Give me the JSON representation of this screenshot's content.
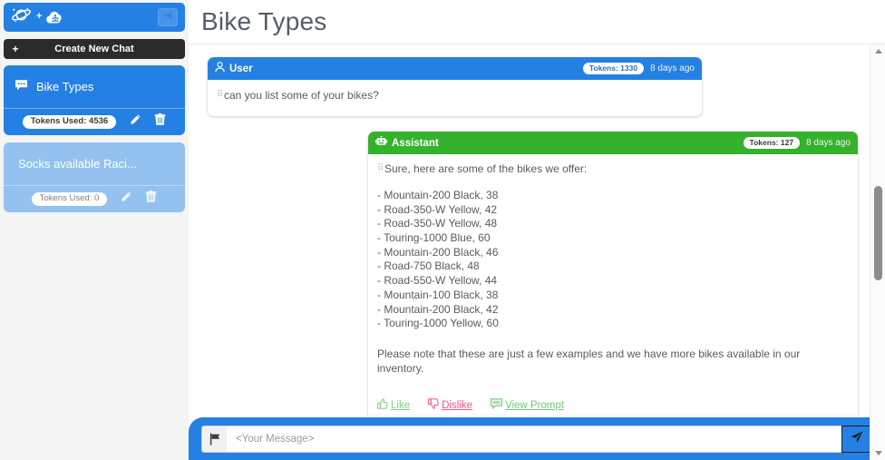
{
  "sidebar": {
    "logo_icon": "planet-sparkle-icon",
    "plus_symbol": "+",
    "cloud_icon": "cloud-brain-icon",
    "collapse_icon": "arrow-right-to-bracket-icon",
    "new_chat": {
      "plus": "+",
      "label": "Create New Chat"
    },
    "chats": [
      {
        "title": "Bike Types",
        "icon": "comment-dots-icon",
        "tokens_label": "Tokens Used: 4536",
        "edit_icon": "pencil-icon",
        "delete_icon": "trash-icon",
        "active": true
      },
      {
        "title": "Socks available Raci...",
        "icon": "comment-dots-icon",
        "tokens_label": "Tokens Used: 0",
        "edit_icon": "pencil-icon",
        "delete_icon": "trash-icon",
        "active": false
      }
    ]
  },
  "header": {
    "title": "Bike Types"
  },
  "messages": {
    "user": {
      "role_icon": "user-icon",
      "role_label": "User",
      "tokens": "Tokens: 1330",
      "timestamp": "8 days ago",
      "text": "can you list some of your bikes?"
    },
    "assistant": {
      "role_icon": "robot-icon",
      "role_label": "Assistant",
      "tokens": "Tokens: 127",
      "timestamp": "8 days ago",
      "intro": "Sure, here are some of the bikes we offer:",
      "bikes": [
        "- Mountain-200 Black, 38",
        "- Road-350-W Yellow, 42",
        "- Road-350-W Yellow, 48",
        "- Touring-1000 Blue, 60",
        "- Mountain-200 Black, 46",
        "- Road-750 Black, 48",
        "- Road-550-W Yellow, 44",
        "- Mountain-100 Black, 38",
        "- Mountain-200 Black, 42",
        "- Touring-1000 Yellow, 60"
      ],
      "note": "Please note that these are just a few examples and we have more bikes available in our inventory.",
      "actions": [
        {
          "label": "Like",
          "icon": "thumbs-up-icon"
        },
        {
          "label": "Dislike",
          "icon": "thumbs-down-icon"
        },
        {
          "label": "View Prompt",
          "icon": "comment-icon"
        }
      ]
    }
  },
  "composer": {
    "left_icon": "flag-icon",
    "placeholder": "<Your Message>",
    "value": "",
    "send_icon": "paper-plane-icon"
  },
  "colors": {
    "brand_blue": "#2580e3",
    "assistant_green": "#35b22c",
    "sidebar_bg": "#f4f4f4",
    "inactive_chat": "#93c2f0",
    "dark_button": "#2b2b2b",
    "like_green": "#7ad17f",
    "dislike_pink": "#f2557e"
  }
}
